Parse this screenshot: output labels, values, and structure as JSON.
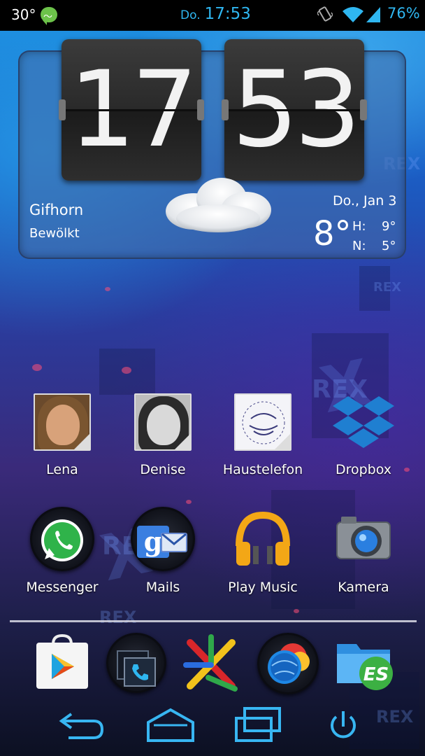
{
  "status_bar": {
    "temperature": "30°",
    "day": "Do.",
    "time": "17:53",
    "battery": "76%",
    "notification_icon": "speech-bubble-pulse-icon",
    "accent_color": "#2fb6f0"
  },
  "clock_widget": {
    "hours": "17",
    "minutes": "53",
    "city": "Gifhorn",
    "condition": "Bewölkt",
    "date": "Do., Jan 3",
    "temperature": "8°",
    "high_label": "H:",
    "high_value": "9°",
    "low_label": "N:",
    "low_value": "5°",
    "weather_icon": "cloud-icon"
  },
  "apps_row1": [
    {
      "label": "Lena",
      "icon": "contact-photo"
    },
    {
      "label": "Denise",
      "icon": "contact-photo"
    },
    {
      "label": "Haustelefon",
      "icon": "contact-photo"
    },
    {
      "label": "Dropbox",
      "icon": "dropbox-icon"
    }
  ],
  "apps_row2": [
    {
      "label": "Messenger",
      "icon": "whatsapp-icon"
    },
    {
      "label": "Mails",
      "icon": "google-mail-icon"
    },
    {
      "label": "Play Music",
      "icon": "headphones-icon"
    },
    {
      "label": "Kamera",
      "icon": "camera-icon"
    }
  ],
  "dock": [
    {
      "icon": "play-store-icon"
    },
    {
      "icon": "phone-icon"
    },
    {
      "icon": "app-drawer-icon"
    },
    {
      "icon": "browser-icon"
    },
    {
      "icon": "es-file-explorer-icon"
    }
  ],
  "nav": [
    {
      "icon": "back-icon"
    },
    {
      "icon": "home-icon"
    },
    {
      "icon": "recent-apps-icon"
    },
    {
      "icon": "power-icon"
    }
  ],
  "wallpaper_text": "REX"
}
